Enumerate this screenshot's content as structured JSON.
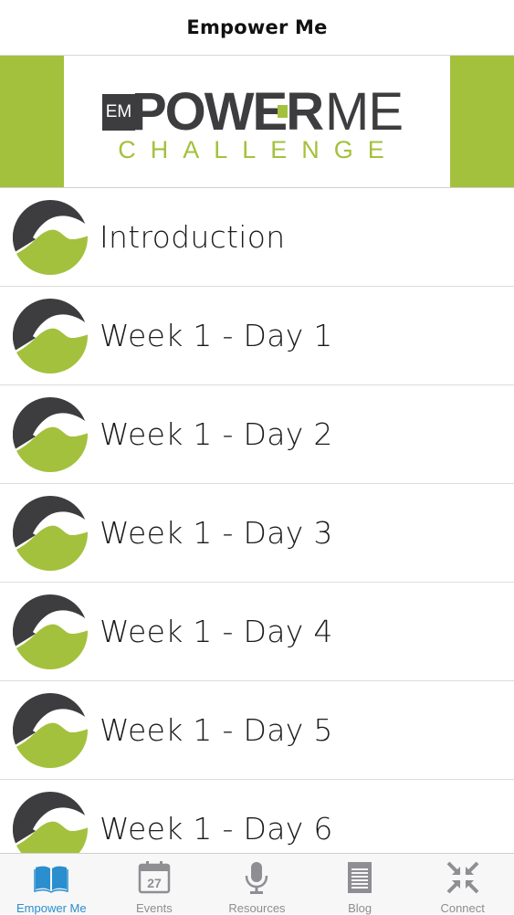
{
  "app": {
    "title": "Empower Me"
  },
  "colors": {
    "accent_green": "#A3C13D",
    "dark_gray": "#3d3d3f",
    "tab_active": "#2a8ecf",
    "tab_inactive": "#8e8e93"
  },
  "banner": {
    "logo_em": "EM",
    "logo_power": "POWER",
    "logo_me": "ME",
    "logo_challenge": "CHALLENGE"
  },
  "list": {
    "items": [
      {
        "label": "Introduction",
        "icon": "empower-me-logo-icon"
      },
      {
        "label": "Week 1 - Day 1",
        "icon": "empower-me-logo-icon"
      },
      {
        "label": "Week 1 - Day 2",
        "icon": "empower-me-logo-icon"
      },
      {
        "label": "Week 1 - Day 3",
        "icon": "empower-me-logo-icon"
      },
      {
        "label": "Week 1 - Day 4",
        "icon": "empower-me-logo-icon"
      },
      {
        "label": "Week 1 - Day 5",
        "icon": "empower-me-logo-icon"
      },
      {
        "label": "Week 1 - Day 6",
        "icon": "empower-me-logo-icon"
      }
    ]
  },
  "tabbar": {
    "tabs": [
      {
        "label": "Empower Me",
        "icon": "book-icon",
        "active": true
      },
      {
        "label": "Events",
        "icon": "calendar-icon",
        "active": false,
        "calendar_day": "27"
      },
      {
        "label": "Resources",
        "icon": "microphone-icon",
        "active": false
      },
      {
        "label": "Blog",
        "icon": "document-icon",
        "active": false
      },
      {
        "label": "Connect",
        "icon": "compress-arrows-icon",
        "active": false
      }
    ]
  }
}
